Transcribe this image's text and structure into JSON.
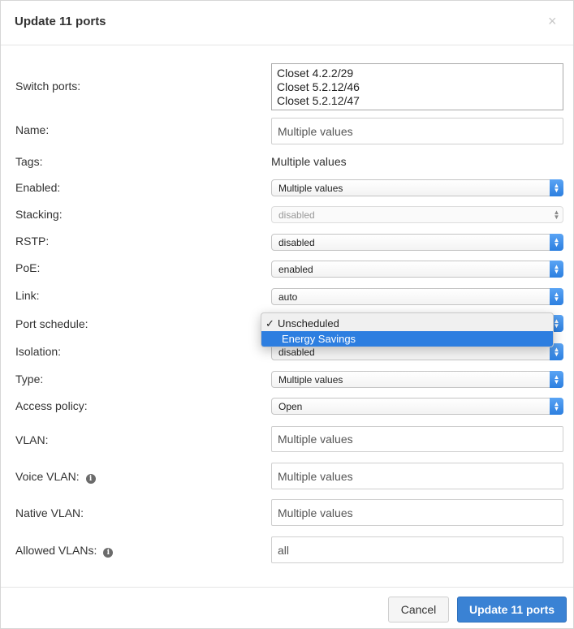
{
  "modal": {
    "title": "Update 11 ports",
    "close_glyph": "×"
  },
  "fields": {
    "switch_ports": {
      "label": "Switch ports:",
      "items": [
        "Closet 4.2.2/29",
        "Closet 5.2.12/46",
        "Closet 5.2.12/47"
      ]
    },
    "name": {
      "label": "Name:",
      "value": "Multiple values"
    },
    "tags": {
      "label": "Tags:",
      "value": "Multiple values"
    },
    "enabled": {
      "label": "Enabled:",
      "value": "Multiple values"
    },
    "stacking": {
      "label": "Stacking:",
      "value": "disabled"
    },
    "rstp": {
      "label": "RSTP:",
      "value": "disabled"
    },
    "poe": {
      "label": "PoE:",
      "value": "enabled"
    },
    "link": {
      "label": "Link:",
      "value": "auto"
    },
    "port_schedule": {
      "label": "Port schedule:",
      "options": [
        "Unscheduled",
        "Energy Savings"
      ],
      "selected": "Unscheduled",
      "highlighted": "Energy Savings",
      "check_glyph": "✓"
    },
    "isolation": {
      "label": "Isolation:",
      "value": "disabled"
    },
    "type": {
      "label": "Type:",
      "value": "Multiple values"
    },
    "access_policy": {
      "label": "Access policy:",
      "value": "Open"
    },
    "vlan": {
      "label": "VLAN:",
      "value": "Multiple values"
    },
    "voice_vlan": {
      "label": "Voice VLAN:",
      "value": "Multiple values"
    },
    "native_vlan": {
      "label": "Native VLAN:",
      "value": "Multiple values"
    },
    "allowed_vlans": {
      "label": "Allowed VLANs:",
      "value": "all"
    }
  },
  "footer": {
    "cancel_label": "Cancel",
    "submit_label": "Update 11 ports"
  },
  "icons": {
    "info": "info-icon",
    "close": "close-icon",
    "select_arrows": "chevron-updown-icon"
  },
  "colors": {
    "primary": "#3a82d4",
    "select_arrow": "#2c7fe0",
    "highlight": "#2d7ee0"
  }
}
